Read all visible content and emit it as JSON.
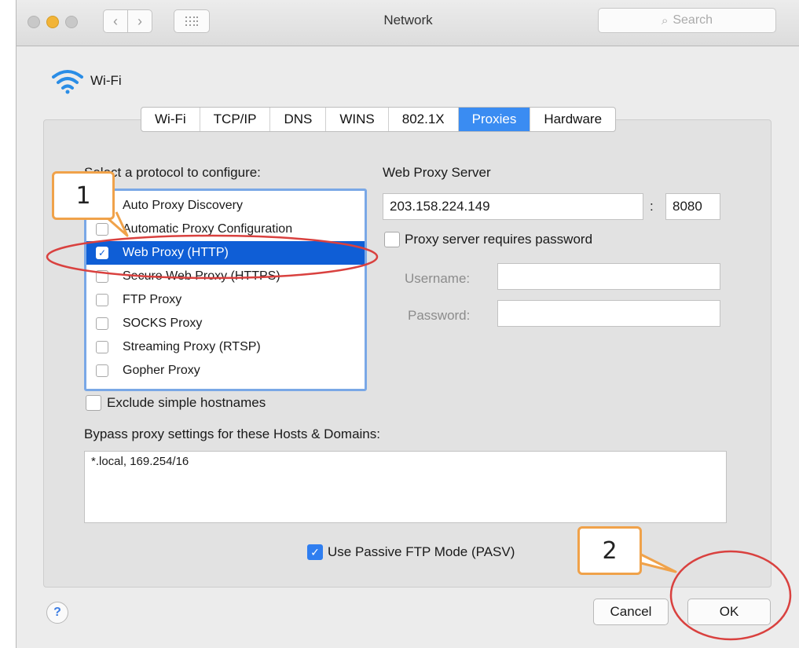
{
  "window": {
    "title": "Network"
  },
  "search": {
    "placeholder": "Search"
  },
  "interface": {
    "name": "Wi-Fi"
  },
  "tabs": [
    "Wi-Fi",
    "TCP/IP",
    "DNS",
    "WINS",
    "802.1X",
    "Proxies",
    "Hardware"
  ],
  "active_tab": "Proxies",
  "protocols": {
    "label": "Select a protocol to configure:",
    "items": [
      {
        "label": "Auto Proxy Discovery",
        "checked": false,
        "selected": false
      },
      {
        "label": "Automatic Proxy Configuration",
        "checked": false,
        "selected": false
      },
      {
        "label": "Web Proxy (HTTP)",
        "checked": true,
        "selected": true
      },
      {
        "label": "Secure Web Proxy (HTTPS)",
        "checked": false,
        "selected": false
      },
      {
        "label": "FTP Proxy",
        "checked": false,
        "selected": false
      },
      {
        "label": "SOCKS Proxy",
        "checked": false,
        "selected": false
      },
      {
        "label": "Streaming Proxy (RTSP)",
        "checked": false,
        "selected": false
      },
      {
        "label": "Gopher Proxy",
        "checked": false,
        "selected": false
      }
    ]
  },
  "server": {
    "label": "Web Proxy Server",
    "host": "203.158.224.149",
    "separator": ":",
    "port": "8080",
    "requires_password_label": "Proxy server requires password",
    "requires_password": false,
    "username_label": "Username:",
    "username": "",
    "password_label": "Password:",
    "password": ""
  },
  "exclude_simple_label": "Exclude simple hostnames",
  "exclude_simple": false,
  "bypass": {
    "label": "Bypass proxy settings for these Hosts & Domains:",
    "value": "*.local, 169.254/16"
  },
  "passive_ftp": {
    "label": "Use Passive FTP Mode (PASV)",
    "checked": true
  },
  "footer": {
    "help": "?",
    "cancel": "Cancel",
    "ok": "OK"
  },
  "annotations": {
    "callout_1": "1",
    "callout_2": "2",
    "stroke_color": "#d9413f",
    "callout_border": "#f0a24a"
  },
  "colors": {
    "accent": "#3a8cf2",
    "selection": "#0f5ed6"
  }
}
